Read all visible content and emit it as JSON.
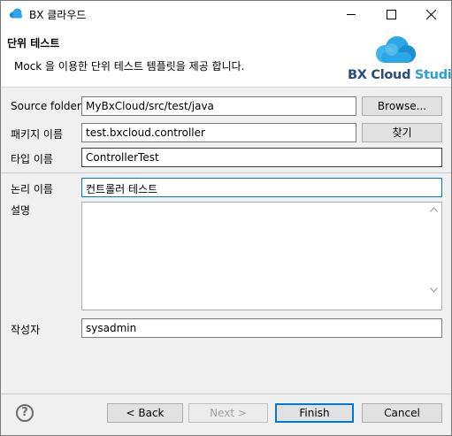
{
  "window": {
    "title": "BX 클라우드",
    "minimize_icon": "minimize-icon",
    "maximize_icon": "maximize-icon",
    "close_icon": "close-icon"
  },
  "header": {
    "title": "단위 테스트",
    "description": "Mock 을 이용한 단위 테스트 템플릿을 제공 합니다.",
    "logo_brand": "BX Cloud",
    "logo_product": "Studio"
  },
  "form": {
    "source_folder": {
      "label": "Source folder:",
      "value": "MyBxCloud/src/test/java",
      "button": "Browse..."
    },
    "package": {
      "label": "패키지 이름",
      "value": "test.bxcloud.controller",
      "button": "찾기"
    },
    "type": {
      "label": "타입 이름",
      "value": "ControllerTest"
    },
    "logical_name": {
      "label": "논리 이름",
      "value": "컨트롤러 테스트"
    },
    "description": {
      "label": "설명",
      "value": ""
    },
    "author": {
      "label": "작성자",
      "value": "sysadmin"
    }
  },
  "footer": {
    "help_icon": "help-icon",
    "back": "< Back",
    "next": "Next >",
    "finish": "Finish",
    "cancel": "Cancel"
  },
  "colors": {
    "accent": "#0078d7",
    "logo_dark": "#2b4b7a",
    "logo_light": "#2a9fd8"
  }
}
